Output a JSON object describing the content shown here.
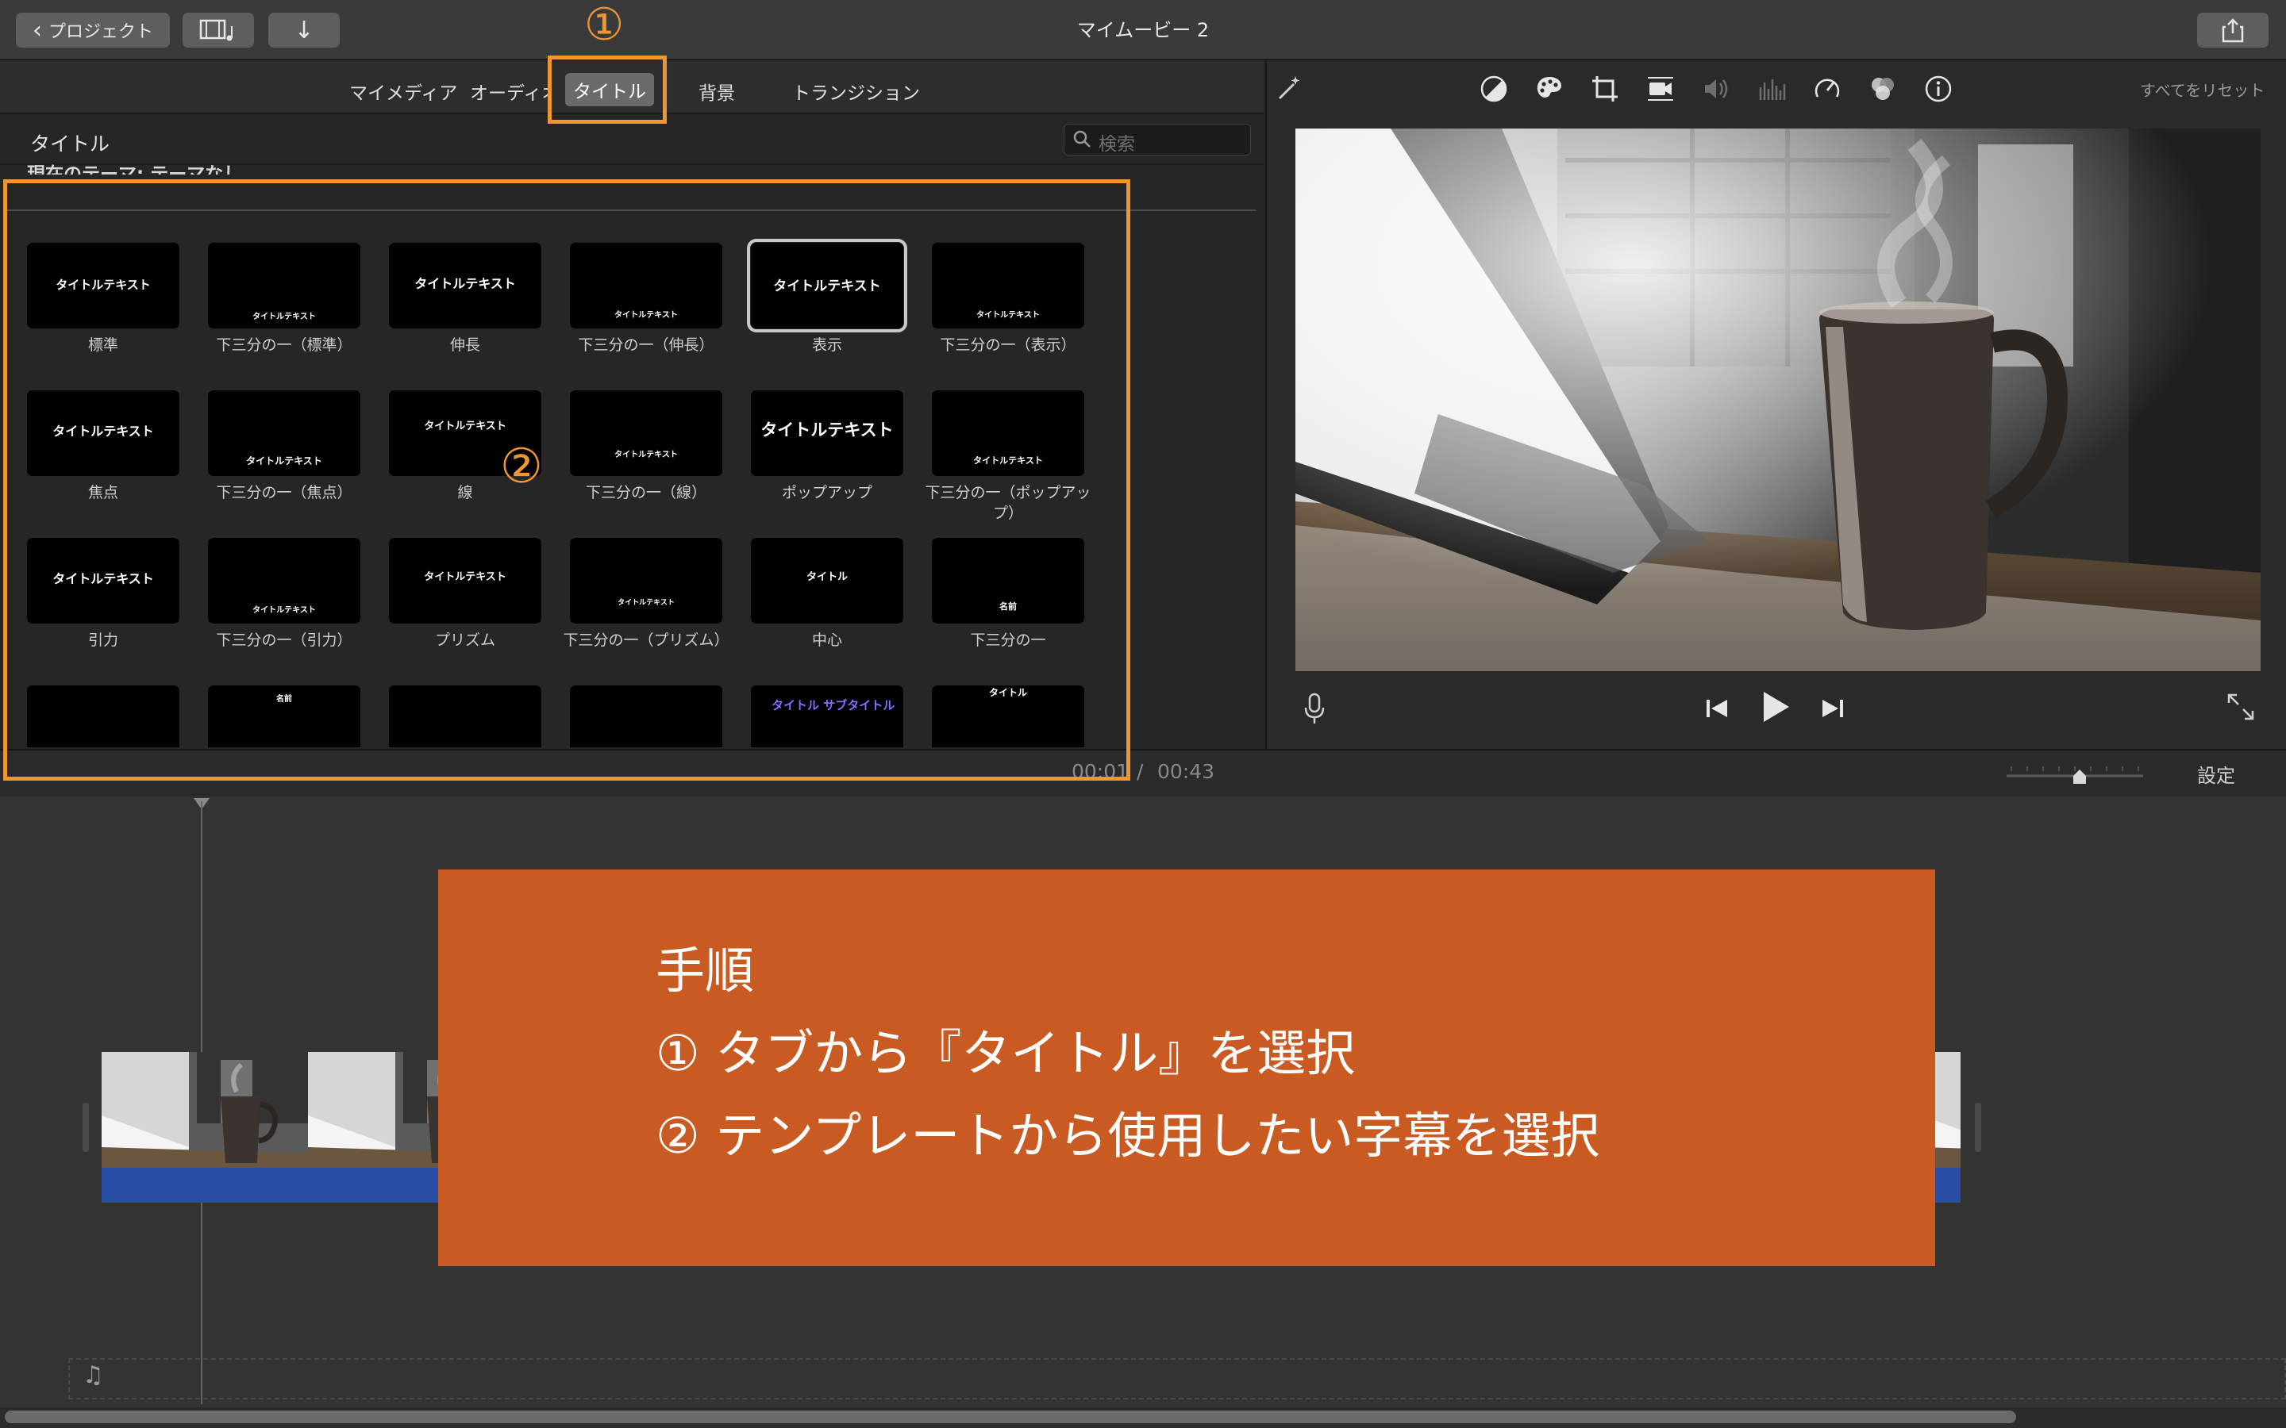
{
  "app": {
    "title": "マイムービー 2"
  },
  "toolbar": {
    "projects_label": "プロジェクト",
    "media_icon": "film-music-icon",
    "import_icon": "download-arrow-icon",
    "share_icon": "share-icon"
  },
  "browser": {
    "tabs": [
      {
        "label": "マイメディア",
        "active": false
      },
      {
        "label": "オーディオ",
        "active": false
      },
      {
        "label": "タイトル",
        "active": true
      },
      {
        "label": "背景",
        "active": false
      },
      {
        "label": "トランジション",
        "active": false
      }
    ],
    "section_title": "タイトル",
    "search_placeholder": "検索",
    "theme_label": "現在のテーマ: テーマなし",
    "titles": [
      {
        "label": "標準",
        "preview": "タイトルテキスト"
      },
      {
        "label": "下三分の一（標準）",
        "preview": "タイトルテキスト"
      },
      {
        "label": "伸長",
        "preview": "タイトルテキスト"
      },
      {
        "label": "下三分の一（伸長）",
        "preview": "タイトルテキスト"
      },
      {
        "label": "表示",
        "preview": "タイトルテキスト"
      },
      {
        "label": "下三分の一（表示）",
        "preview": "タイトルテキスト"
      },
      {
        "label": "焦点",
        "preview": "タイトルテキスト"
      },
      {
        "label": "下三分の一（焦点）",
        "preview": "タイトルテキスト"
      },
      {
        "label": "線",
        "preview": "タイトルテキスト"
      },
      {
        "label": "下三分の一（線）",
        "preview": "タイトルテキスト"
      },
      {
        "label": "ポップアップ",
        "preview": "タイトルテキスト"
      },
      {
        "label": "下三分の一（ポップアップ）",
        "preview": "タイトルテキスト"
      },
      {
        "label": "引力",
        "preview": "タイトルテキスト"
      },
      {
        "label": "下三分の一（引力）",
        "preview": "タイトルテキスト"
      },
      {
        "label": "プリズム",
        "preview": "タイトルテキスト"
      },
      {
        "label": "下三分の一（プリズム）",
        "preview": "タイトルテキスト"
      },
      {
        "label": "中心",
        "preview": "タイトル"
      },
      {
        "label": "下三分の一",
        "preview": "名前"
      },
      {
        "label": "",
        "preview": ""
      },
      {
        "label": "",
        "preview": "名前"
      },
      {
        "label": "",
        "preview": ""
      },
      {
        "label": "",
        "preview": ""
      },
      {
        "label": "",
        "preview": "タイトル サブタイトル"
      },
      {
        "label": "",
        "preview": "タイトル"
      }
    ]
  },
  "viewer": {
    "reset_label": "すべてをリセット"
  },
  "timebar": {
    "current": "00:01",
    "separator": "/",
    "total": "00:43",
    "settings_label": "設定"
  },
  "annotations": {
    "marker1": "①",
    "marker2": "②",
    "instructions": {
      "heading": "手順",
      "step1": "① タブから『タイトル』を選択",
      "step2": "② テンプレートから使用したい字幕を選択"
    }
  },
  "colors": {
    "accent_orange": "#f0962e",
    "instruction_bg": "#c85a22",
    "clip_blue": "#2a4ea3"
  }
}
